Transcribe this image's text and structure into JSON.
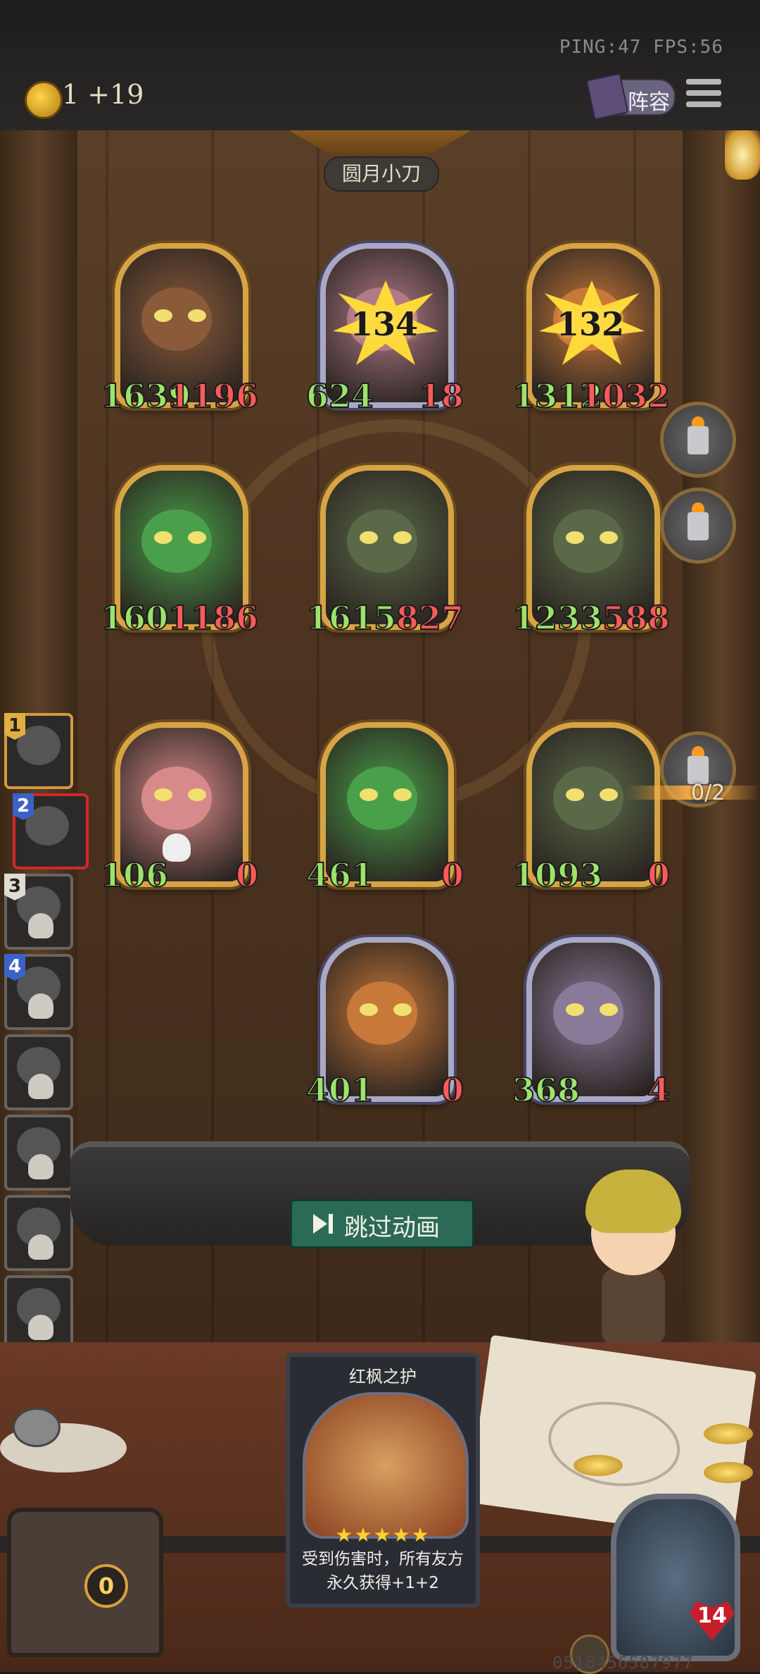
{
  "hud": {
    "ping_fps": "PING:47   FPS:56",
    "gold": "1 +19",
    "lineup_label": "阵容"
  },
  "banner": "圆月小刀",
  "board": {
    "rows": [
      [
        {
          "atk": "1639",
          "hp": "1196",
          "frame": "gold",
          "color": "#8a5a3a"
        },
        {
          "atk": "624",
          "hp": "18",
          "frame": "silver",
          "color": "#b07a86",
          "damage": "134"
        },
        {
          "atk": "1312",
          "hp": "1032",
          "frame": "gold",
          "color": "#c87838",
          "damage": "132"
        }
      ],
      [
        {
          "atk": "1601",
          "hp": "1186",
          "frame": "gold",
          "color": "#4aa04a"
        },
        {
          "atk": "1615",
          "hp": "827",
          "frame": "gold",
          "color": "#5a6a48"
        },
        {
          "atk": "1233",
          "hp": "588",
          "frame": "gold",
          "color": "#5a6a48"
        }
      ],
      [
        {
          "atk": "106",
          "hp": "0",
          "frame": "gold",
          "color": "#d88a8a",
          "dead": true
        },
        {
          "atk": "461",
          "hp": "0",
          "frame": "gold",
          "color": "#4aa04a"
        },
        {
          "atk": "1093",
          "hp": "0",
          "frame": "gold",
          "color": "#5a6a48"
        }
      ],
      [
        {
          "atk": "401",
          "hp": "0",
          "frame": "silver",
          "color": "#c87838"
        },
        {
          "atk": "368",
          "hp": "4",
          "frame": "silver",
          "color": "#8a7a9a"
        }
      ]
    ]
  },
  "token_counter": "0/2",
  "queue": [
    {
      "num": "1",
      "style": "gold",
      "dead": false
    },
    {
      "num": "2",
      "style": "blue",
      "dead": false,
      "selected": true
    },
    {
      "num": "3",
      "style": "white",
      "dead": true
    },
    {
      "num": "4",
      "style": "blue",
      "dead": true
    },
    {
      "num": "",
      "dead": true
    },
    {
      "num": "",
      "dead": true
    },
    {
      "num": "",
      "dead": true
    },
    {
      "num": "",
      "dead": true
    }
  ],
  "skip_label": "跳过动画",
  "featured_card": {
    "title": "红枫之护",
    "stars": "★★★★★",
    "desc": "受到伤害时，所有友方永久获得+1+2"
  },
  "chest_count": "0",
  "hero_hp": "14",
  "serial": "0518456587977"
}
